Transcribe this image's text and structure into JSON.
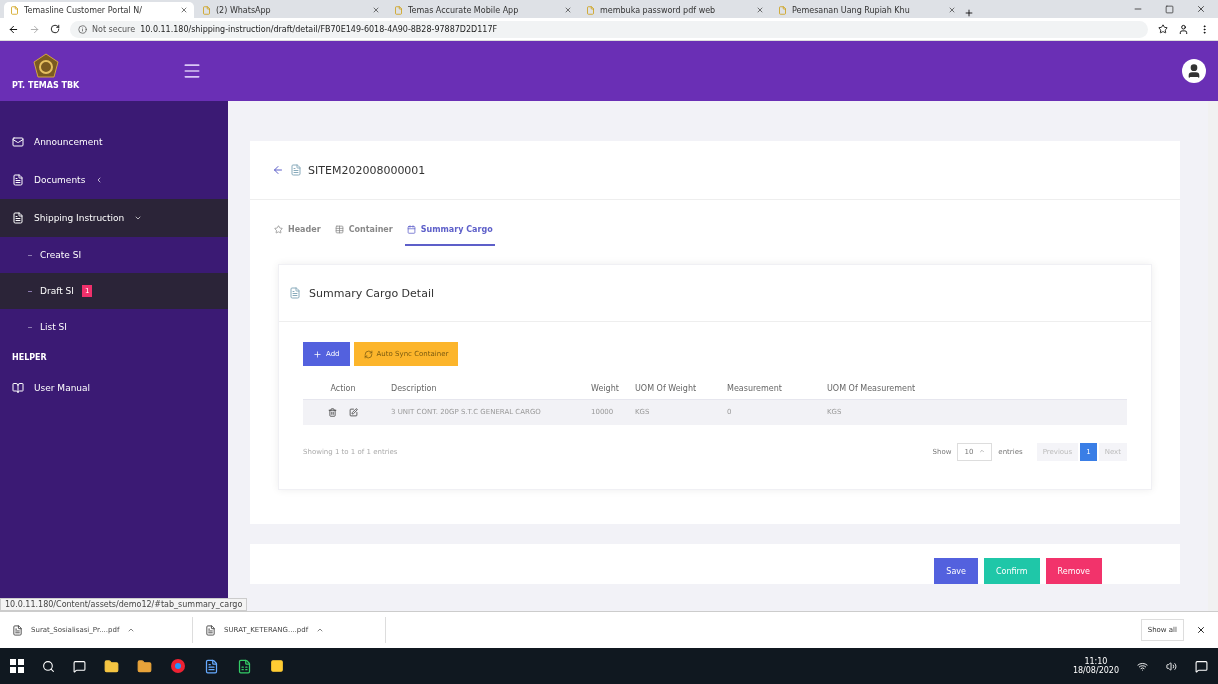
{
  "browser": {
    "tabs": [
      {
        "title": "Temasline Customer Portal N/",
        "selected": true
      },
      {
        "title": "(2) WhatsApp",
        "selected": false
      },
      {
        "title": "Temas Accurate Mobile App",
        "selected": false
      },
      {
        "title": "membuka password pdf web",
        "selected": false
      },
      {
        "title": "Pemesanan Uang Rupiah Khu",
        "selected": false
      }
    ],
    "security": "Not secure",
    "url": "10.0.11.180/shipping-instruction/draft/detail/FB70E149-6018-4A90-8B28-97887D2D117F",
    "status_url": "10.0.11.180/Content/assets/demo12/#tab_summary_cargo"
  },
  "app": {
    "brand": "PT. TEMAS TBK"
  },
  "sidebar": {
    "items": [
      {
        "kind": "link",
        "label": "Announcement",
        "selected": false
      },
      {
        "kind": "group",
        "label": "Documents",
        "expanded": false,
        "selected": false
      },
      {
        "kind": "group",
        "label": "Shipping Instruction",
        "expanded": true,
        "selected": true,
        "children": [
          {
            "label": "Create SI",
            "selected": false
          },
          {
            "label": "Draft SI",
            "selected": true,
            "badge": "1"
          },
          {
            "label": "List SI",
            "selected": false
          }
        ]
      },
      {
        "kind": "section",
        "label": "HELPER"
      },
      {
        "kind": "link",
        "label": "User Manual",
        "selected": false
      }
    ]
  },
  "page": {
    "title": "SITEM202008000001",
    "tabs": [
      {
        "label": "Header",
        "selected": false
      },
      {
        "label": "Container",
        "selected": false
      },
      {
        "label": "Summary Cargo",
        "selected": true
      }
    ],
    "section_title": "Summary Cargo Detail",
    "buttons": [
      "Add",
      "Auto Sync Container"
    ],
    "table": {
      "columns": [
        "Action",
        "Description",
        "Weight",
        "UOM Of Weight",
        "Measurement",
        "UOM Of Measurement"
      ],
      "rows": [
        {
          "cells": [
            "",
            "3 UNIT CONT. 20GP S.T.C GENERAL CARGO",
            "10000",
            "KGS",
            "0",
            "KGS"
          ]
        }
      ]
    },
    "info": "Showing 1 to 1 of 1 entries",
    "length": {
      "before": "Show",
      "value": "10",
      "after": "entries"
    },
    "pagination": [
      {
        "label": "Previous",
        "selected": false
      },
      {
        "label": "1",
        "selected": true
      },
      {
        "label": "Next",
        "selected": false
      }
    ],
    "actions": [
      {
        "label": "Save",
        "kind": "primary"
      },
      {
        "label": "Confirm",
        "kind": "success"
      },
      {
        "label": "Remove",
        "kind": "danger"
      }
    ]
  },
  "downloads": {
    "files": [
      "Surat_Sosialisasi_Pr....pdf",
      "SURAT_KETERANG....pdf"
    ],
    "show_all": "Show all"
  },
  "taskbar": {
    "time": "11:10",
    "date": "18/08/2020"
  }
}
